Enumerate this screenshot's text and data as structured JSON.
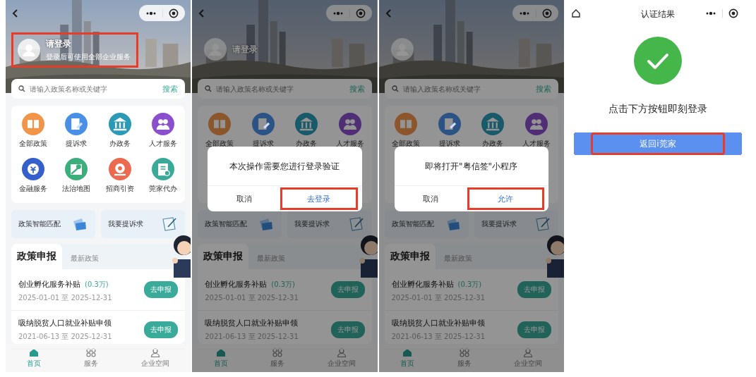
{
  "screens": [
    {
      "kind": "home",
      "header": {
        "title": "请登录",
        "subtitle": "登录后可使用全部企业服务",
        "highlighted": true
      },
      "search": {
        "placeholder": "请输入政策名称或关键字",
        "button": "搜索"
      },
      "services": [
        {
          "label": "全部政策",
          "color": "#f0954a"
        },
        {
          "label": "提诉求",
          "color": "#4a8fe6"
        },
        {
          "label": "办政务",
          "color": "#2a9ab6"
        },
        {
          "label": "人才服务",
          "color": "#8a4fcc"
        },
        {
          "label": "金融服务",
          "color": "#3560cc"
        },
        {
          "label": "法治地图",
          "color": "#3cae7c"
        },
        {
          "label": "招商引资",
          "color": "#ec6a50"
        },
        {
          "label": "莞家代办",
          "color": "#3aaa98"
        }
      ],
      "shortcuts": [
        "政策智能匹配",
        "我要提诉求"
      ],
      "tabs": [
        {
          "label": "政策申报",
          "selected": true
        },
        {
          "label": "最新政策",
          "selected": false
        }
      ],
      "policies": [
        {
          "name": "创业孵化服务补贴",
          "amount": "(0.3万)",
          "dates": "2025-01-01 至 2025-12-31",
          "button": "去申报"
        },
        {
          "name": "吸纳脱贫人口就业补贴申领",
          "dates": "2021-06-13 至 2025-12-31",
          "button": "去申报"
        }
      ],
      "nav": [
        {
          "label": "首页",
          "selected": true
        },
        {
          "label": "服务",
          "selected": false
        },
        {
          "label": "企业空间",
          "selected": false
        }
      ]
    },
    {
      "kind": "home",
      "header": {
        "title": "请登录",
        "highlighted": false
      },
      "search": {
        "placeholder": "请输入政策名称或关键字",
        "button": "搜索"
      },
      "services": [
        {
          "label": "全部政策",
          "color": "#8b562b"
        },
        {
          "label": "提诉求",
          "color": "#2b5385"
        },
        {
          "label": "办政务",
          "color": "#18596a"
        },
        {
          "label": "人才服务",
          "color": "#502e76"
        }
      ],
      "shortcuts": [
        "政策智能匹配",
        "我要提诉求"
      ],
      "tabs": [
        {
          "label": "政策申报",
          "selected": true
        },
        {
          "label": "最新政策",
          "selected": false
        }
      ],
      "policies": [
        {
          "name": "创业孵化服务补贴",
          "amount": "(0.3万)",
          "dates": "2025-01-01 至 2025-12-31",
          "button": "去申报"
        },
        {
          "name": "吸纳脱贫人口就业补贴申领",
          "dates": "2021-06-13 至 2025-12-31",
          "button": "去申报"
        }
      ],
      "nav": [
        {
          "label": "首页",
          "selected": true
        },
        {
          "label": "服务",
          "selected": false
        },
        {
          "label": "企业空间",
          "selected": false
        }
      ],
      "dialog": {
        "message": "本次操作需要您进行登录验证",
        "cancel": "取消",
        "confirm": "去登录",
        "confirm_highlighted": true
      }
    },
    {
      "kind": "home",
      "header": {
        "highlighted": false
      },
      "search": {
        "placeholder": "请输入政策名称或关键字",
        "button": "搜索"
      },
      "services": [
        {
          "label": "全部政策",
          "color": "#8b562b"
        },
        {
          "label": "提诉求",
          "color": "#2b5385"
        },
        {
          "label": "办政务",
          "color": "#18596a"
        },
        {
          "label": "人才服务",
          "color": "#502e76"
        }
      ],
      "shortcuts": [
        "政策智能匹配",
        "我要提诉求"
      ],
      "tabs": [
        {
          "label": "政策申报",
          "selected": true
        },
        {
          "label": "最新政策",
          "selected": false
        }
      ],
      "policies": [
        {
          "name": "创业孵化服务补贴",
          "amount": "(0.3万)",
          "dates": "2025-01-01 至 2025-12-31",
          "button": "去申报"
        },
        {
          "name": "吸纳脱贫人口就业补贴申领",
          "dates": "2021-06-13 至 2025-12-31",
          "button": "去申报"
        }
      ],
      "nav": [
        {
          "label": "首页",
          "selected": true
        },
        {
          "label": "服务",
          "selected": false
        },
        {
          "label": "企业空间",
          "selected": false
        }
      ],
      "dialog": {
        "message": "即将打开\"粤信签\"小程序",
        "cancel": "取消",
        "confirm": "允许",
        "confirm_highlighted": true
      }
    },
    {
      "kind": "result",
      "title": "认证结果",
      "message": "点击下方按钮即刻登录",
      "button": {
        "label": "返回i莞家",
        "highlighted": true
      }
    }
  ]
}
